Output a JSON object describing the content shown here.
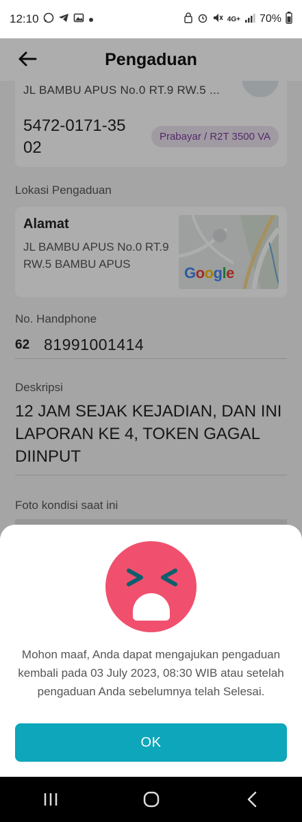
{
  "status_bar": {
    "time": "12:10",
    "battery": "70%",
    "network": "4G+"
  },
  "header": {
    "title": "Pengaduan"
  },
  "customer_card": {
    "address": "JL BAMBU APUS No.0 RT.9 RW.5 ...",
    "meter_id": "5472-0171-35 02",
    "tariff_badge": "Prabayar / R2T 3500 VA"
  },
  "location": {
    "section_label": "Lokasi Pengaduan",
    "title": "Alamat",
    "address": "JL BAMBU APUS No.0 RT.9 RW.5 BAMBU APUS",
    "map_logo": "Google"
  },
  "phone": {
    "label": "No. Handphone",
    "country_code": "62",
    "number": "81991001414"
  },
  "description": {
    "label": "Deskripsi",
    "text": "12 JAM SEJAK KEJADIAN, DAN INI LAPORAN KE 4, TOKEN GAGAL DIINPUT"
  },
  "photo": {
    "label": "Foto kondisi saat ini"
  },
  "dialog": {
    "message": "Mohon maaf, Anda dapat mengajukan pengaduan kembali pada 03 July 2023, 08:30 WIB atau setelah pengaduan Anda sebelumnya telah Selesai.",
    "ok_label": "OK"
  },
  "colors": {
    "accent": "#0ea6ba",
    "emoji_face": "#f0506e",
    "badge_text": "#7a3e97",
    "badge_bg": "#ece3f1"
  }
}
